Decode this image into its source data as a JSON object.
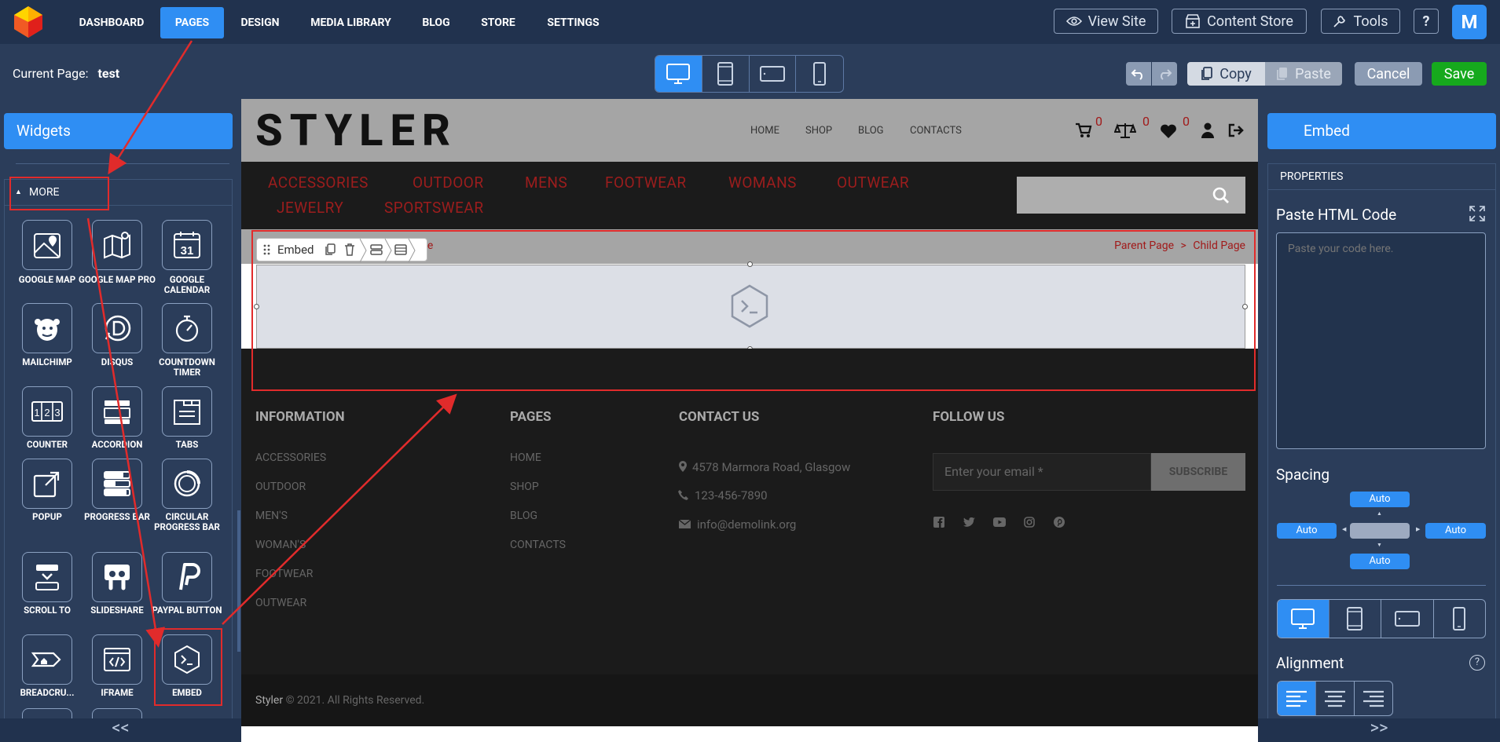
{
  "topnav": {
    "items": [
      "DASHBOARD",
      "PAGES",
      "DESIGN",
      "MEDIA LIBRARY",
      "BLOG",
      "STORE",
      "SETTINGS"
    ],
    "active": "PAGES",
    "view_site": "View Site",
    "content_store": "Content Store",
    "tools": "Tools",
    "help": "?",
    "avatar": "M"
  },
  "pagebar": {
    "current_label": "Current Page:",
    "current_value": "test",
    "copy": "Copy",
    "paste": "Paste",
    "cancel": "Cancel",
    "save": "Save"
  },
  "left": {
    "title": "Widgets",
    "section": "MORE",
    "widgets": [
      {
        "label": "GOOGLE MAP",
        "icon": "google-map-icon"
      },
      {
        "label": "GOOGLE MAP PRO",
        "icon": "google-map-pro-icon"
      },
      {
        "label": "GOOGLE CALENDAR",
        "icon": "google-calendar-icon"
      },
      {
        "label": "MAILCHIMP",
        "icon": "mailchimp-icon"
      },
      {
        "label": "DISQUS",
        "icon": "disqus-icon"
      },
      {
        "label": "COUNTDOWN TIMER",
        "icon": "countdown-timer-icon"
      },
      {
        "label": "COUNTER",
        "icon": "counter-icon"
      },
      {
        "label": "ACCORDION",
        "icon": "accordion-icon"
      },
      {
        "label": "TABS",
        "icon": "tabs-icon"
      },
      {
        "label": "POPUP",
        "icon": "popup-icon"
      },
      {
        "label": "PROGRESS BAR",
        "icon": "progress-bar-icon"
      },
      {
        "label": "CIRCULAR PROGRESS BAR",
        "icon": "circular-progress-icon"
      },
      {
        "label": "SCROLL TO",
        "icon": "scroll-to-icon"
      },
      {
        "label": "SLIDESHARE",
        "icon": "slideshare-icon"
      },
      {
        "label": "PAYPAL BUTTON",
        "icon": "paypal-icon"
      },
      {
        "label": "BREADCRU...",
        "icon": "breadcrumb-icon"
      },
      {
        "label": "IFRAME",
        "icon": "iframe-icon"
      },
      {
        "label": "EMBED",
        "icon": "embed-icon"
      }
    ],
    "calendar_day": "31"
  },
  "site": {
    "brand": "STYLER",
    "menu": [
      "HOME",
      "SHOP",
      "BLOG",
      "CONTACTS"
    ],
    "counts": [
      "0",
      "0",
      "0"
    ],
    "categories_row1": [
      "ACCESSORIES",
      "OUTDOOR",
      "MENS",
      "FOOTWEAR",
      "WOMANS",
      "OUTWEAR"
    ],
    "categories_row2": [
      "JEWELRY",
      "SPORTSWEAR"
    ],
    "breadcrumb_left": "ge",
    "breadcrumb_parent": "Parent Page",
    "breadcrumb_sep": ">",
    "breadcrumb_child": "Child Page",
    "toolbar_label": "Embed",
    "footer": {
      "information": "INFORMATION",
      "info_links": [
        "ACCESSORIES",
        "OUTDOOR",
        "MEN'S",
        "WOMAN'S",
        "FOOTWEAR",
        "OUTWEAR"
      ],
      "pages": "PAGES",
      "page_links": [
        "HOME",
        "SHOP",
        "BLOG",
        "CONTACTS"
      ],
      "contact": "CONTACT US",
      "address": "4578 Marmora Road, Glasgow",
      "phone": "123-456-7890",
      "email": "info@demolink.org",
      "follow": "FOLLOW US",
      "email_placeholder": "Enter your email *",
      "subscribe": "SUBSCRIBE",
      "copyright_brand": "Styler",
      "copyright_text": "© 2021. All Rights Reserved."
    }
  },
  "right": {
    "title": "Embed",
    "section": "PROPERTIES",
    "paste_label": "Paste HTML Code",
    "placeholder": "Paste your code here.",
    "spacing": "Spacing",
    "auto": "Auto",
    "alignment": "Alignment",
    "help": "?"
  },
  "collapse_left": "<<",
  "collapse_right": ">>",
  "colors": {
    "accent": "#2f8ef3",
    "panel": "#2b3d5a",
    "annotation": "#e12b2b",
    "save": "#16a91d"
  }
}
